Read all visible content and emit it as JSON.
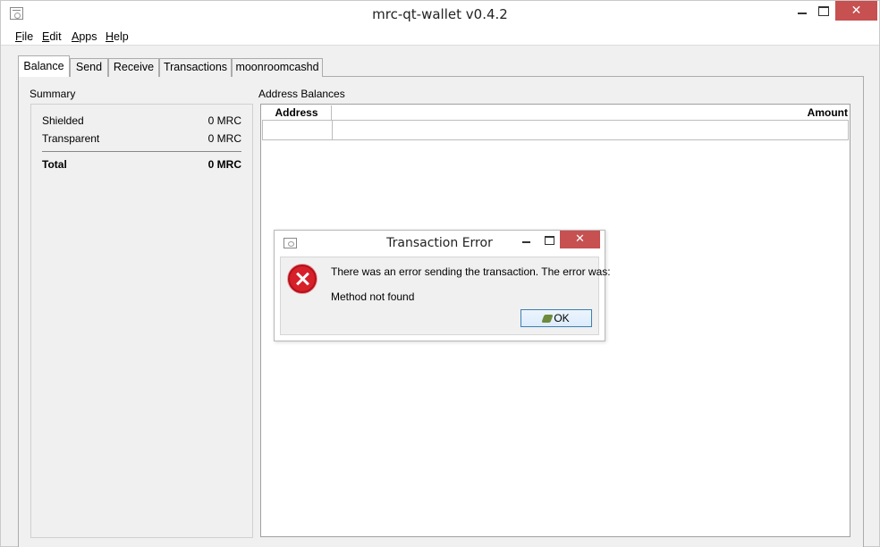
{
  "window": {
    "title": "mrc-qt-wallet v0.4.2",
    "close_glyph": "✕"
  },
  "menubar": {
    "items": [
      {
        "label": "File",
        "mnemonic": "F",
        "rest": "ile"
      },
      {
        "label": "Edit",
        "mnemonic": "E",
        "rest": "dit"
      },
      {
        "label": "Apps",
        "mnemonic": "A",
        "rest": "pps"
      },
      {
        "label": "Help",
        "mnemonic": "H",
        "rest": "elp"
      }
    ]
  },
  "tabs": [
    {
      "label": "Balance",
      "active": true
    },
    {
      "label": "Send",
      "active": false
    },
    {
      "label": "Receive",
      "active": false
    },
    {
      "label": "Transactions",
      "active": false
    },
    {
      "label": "moonroomcashd",
      "active": false
    }
  ],
  "summary": {
    "title": "Summary",
    "shielded_label": "Shielded",
    "shielded_value": "0 MRC",
    "transparent_label": "Transparent",
    "transparent_value": "0 MRC",
    "total_label": "Total",
    "total_value": "0 MRC"
  },
  "address_balances": {
    "title": "Address Balances",
    "columns": [
      "Address",
      "Amount"
    ]
  },
  "dialog": {
    "title": "Transaction Error",
    "message": "There was an error sending the transaction. The error was:",
    "detail": "Method not found",
    "ok_label": "OK",
    "close_glyph": "✕",
    "icon": "error-icon"
  }
}
